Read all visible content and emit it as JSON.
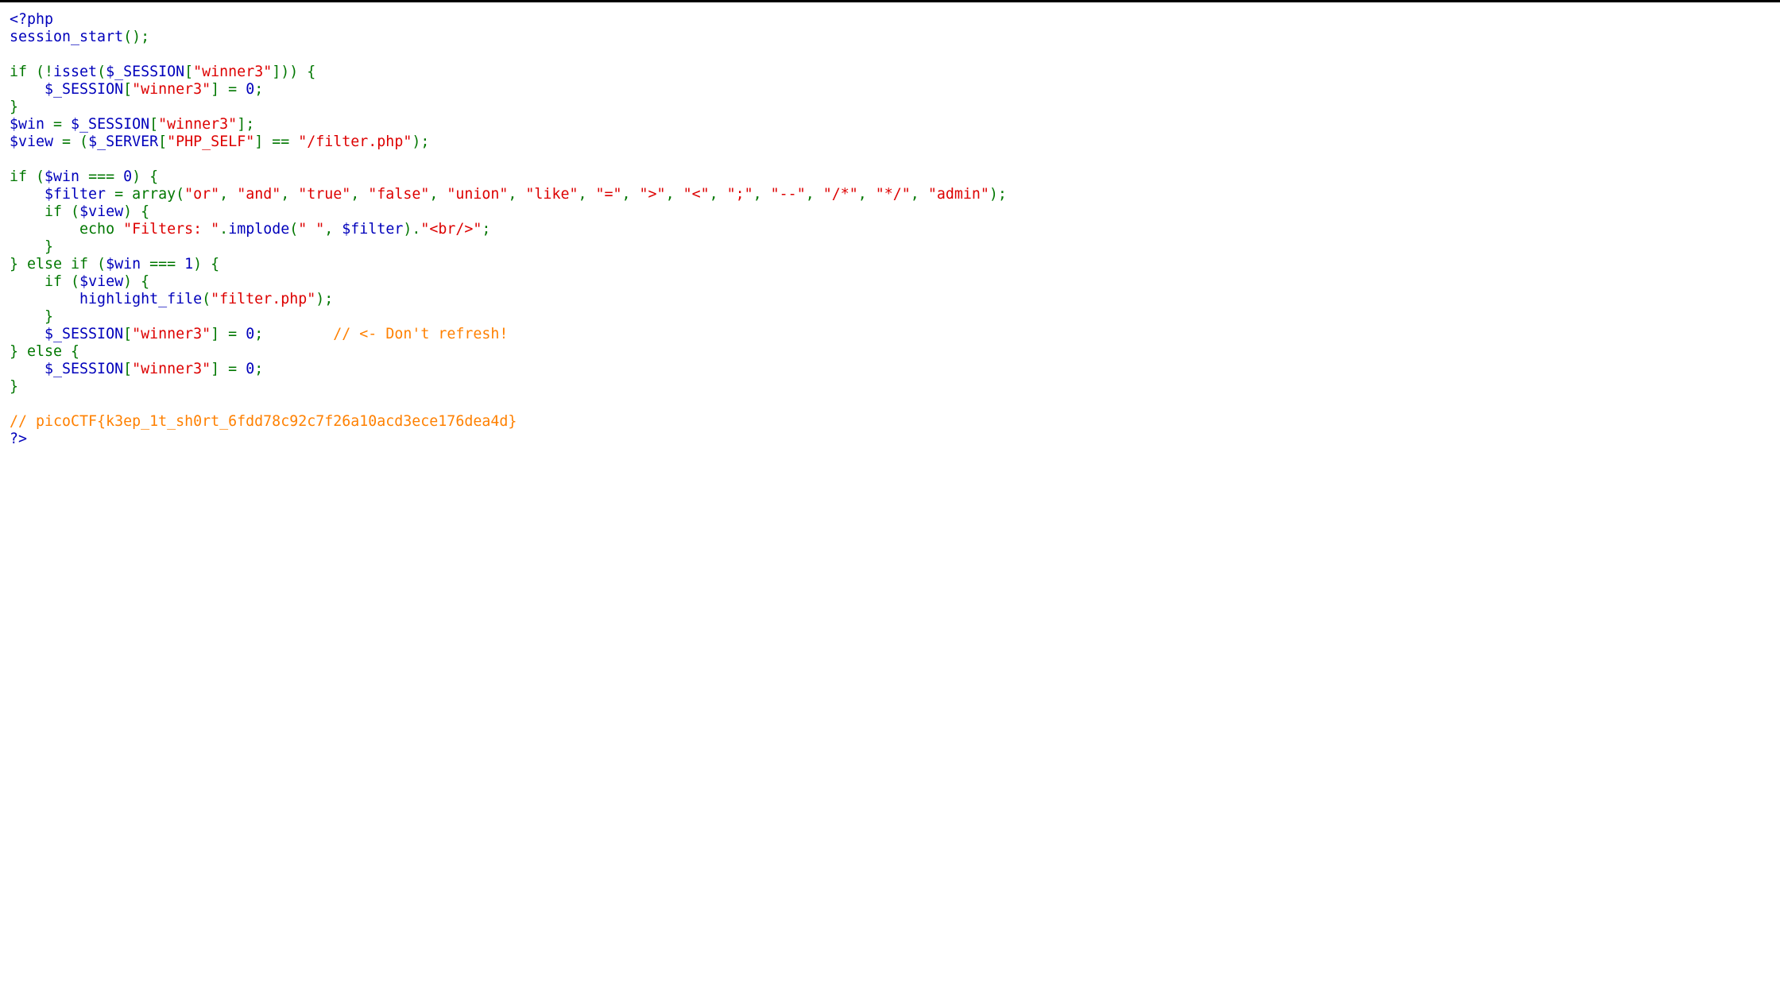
{
  "colors": {
    "default": "#0000BB",
    "keyword": "#007700",
    "string": "#DD0000",
    "comment": "#FF8000",
    "background": "#FFFFFF"
  },
  "code_lines": [
    [
      [
        "d",
        "<?php"
      ]
    ],
    [
      [
        "d",
        "session_start"
      ],
      [
        "k",
        "();"
      ]
    ],
    [],
    [
      [
        "k",
        "if (!"
      ],
      [
        "d",
        "isset"
      ],
      [
        "k",
        "("
      ],
      [
        "d",
        "$_SESSION"
      ],
      [
        "k",
        "["
      ],
      [
        "s",
        "\"winner3\""
      ],
      [
        "k",
        "])) {"
      ]
    ],
    [
      [
        "d",
        "    $_SESSION"
      ],
      [
        "k",
        "["
      ],
      [
        "s",
        "\"winner3\""
      ],
      [
        "k",
        "] = "
      ],
      [
        "d",
        "0"
      ],
      [
        "k",
        ";"
      ]
    ],
    [
      [
        "k",
        "}"
      ]
    ],
    [
      [
        "d",
        "$win "
      ],
      [
        "k",
        "= "
      ],
      [
        "d",
        "$_SESSION"
      ],
      [
        "k",
        "["
      ],
      [
        "s",
        "\"winner3\""
      ],
      [
        "k",
        "];"
      ]
    ],
    [
      [
        "d",
        "$view "
      ],
      [
        "k",
        "= ("
      ],
      [
        "d",
        "$_SERVER"
      ],
      [
        "k",
        "["
      ],
      [
        "s",
        "\"PHP_SELF\""
      ],
      [
        "k",
        "] == "
      ],
      [
        "s",
        "\"/filter.php\""
      ],
      [
        "k",
        ");"
      ]
    ],
    [],
    [
      [
        "k",
        "if ("
      ],
      [
        "d",
        "$win "
      ],
      [
        "k",
        "=== "
      ],
      [
        "d",
        "0"
      ],
      [
        "k",
        ") {"
      ]
    ],
    [
      [
        "d",
        "    $filter "
      ],
      [
        "k",
        "= array("
      ],
      [
        "s",
        "\"or\""
      ],
      [
        "k",
        ", "
      ],
      [
        "s",
        "\"and\""
      ],
      [
        "k",
        ", "
      ],
      [
        "s",
        "\"true\""
      ],
      [
        "k",
        ", "
      ],
      [
        "s",
        "\"false\""
      ],
      [
        "k",
        ", "
      ],
      [
        "s",
        "\"union\""
      ],
      [
        "k",
        ", "
      ],
      [
        "s",
        "\"like\""
      ],
      [
        "k",
        ", "
      ],
      [
        "s",
        "\"=\""
      ],
      [
        "k",
        ", "
      ],
      [
        "s",
        "\">\""
      ],
      [
        "k",
        ", "
      ],
      [
        "s",
        "\"<\""
      ],
      [
        "k",
        ", "
      ],
      [
        "s",
        "\";\""
      ],
      [
        "k",
        ", "
      ],
      [
        "s",
        "\"--\""
      ],
      [
        "k",
        ", "
      ],
      [
        "s",
        "\"/*\""
      ],
      [
        "k",
        ", "
      ],
      [
        "s",
        "\"*/\""
      ],
      [
        "k",
        ", "
      ],
      [
        "s",
        "\"admin\""
      ],
      [
        "k",
        ");"
      ]
    ],
    [
      [
        "k",
        "    if ("
      ],
      [
        "d",
        "$view"
      ],
      [
        "k",
        ") {"
      ]
    ],
    [
      [
        "k",
        "        echo "
      ],
      [
        "s",
        "\"Filters: \""
      ],
      [
        "k",
        "."
      ],
      [
        "d",
        "implode"
      ],
      [
        "k",
        "("
      ],
      [
        "s",
        "\" \""
      ],
      [
        "k",
        ", "
      ],
      [
        "d",
        "$filter"
      ],
      [
        "k",
        ")."
      ],
      [
        "s",
        "\"<br/>\""
      ],
      [
        "k",
        ";"
      ]
    ],
    [
      [
        "k",
        "    }"
      ]
    ],
    [
      [
        "k",
        "} else if ("
      ],
      [
        "d",
        "$win "
      ],
      [
        "k",
        "=== "
      ],
      [
        "d",
        "1"
      ],
      [
        "k",
        ") {"
      ]
    ],
    [
      [
        "k",
        "    if ("
      ],
      [
        "d",
        "$view"
      ],
      [
        "k",
        ") {"
      ]
    ],
    [
      [
        "d",
        "        highlight_file"
      ],
      [
        "k",
        "("
      ],
      [
        "s",
        "\"filter.php\""
      ],
      [
        "k",
        ");"
      ]
    ],
    [
      [
        "k",
        "    }"
      ]
    ],
    [
      [
        "d",
        "    $_SESSION"
      ],
      [
        "k",
        "["
      ],
      [
        "s",
        "\"winner3\""
      ],
      [
        "k",
        "] = "
      ],
      [
        "d",
        "0"
      ],
      [
        "k",
        ";        "
      ],
      [
        "c",
        "// <- Don't refresh!"
      ]
    ],
    [
      [
        "k",
        "} else {"
      ]
    ],
    [
      [
        "d",
        "    $_SESSION"
      ],
      [
        "k",
        "["
      ],
      [
        "s",
        "\"winner3\""
      ],
      [
        "k",
        "] = "
      ],
      [
        "d",
        "0"
      ],
      [
        "k",
        ";"
      ]
    ],
    [
      [
        "k",
        "}"
      ]
    ],
    [],
    [
      [
        "c",
        "// picoCTF{k3ep_1t_sh0rt_6fdd78c92c7f26a10acd3ece176dea4d}"
      ]
    ],
    [
      [
        "d",
        "?>"
      ]
    ]
  ]
}
